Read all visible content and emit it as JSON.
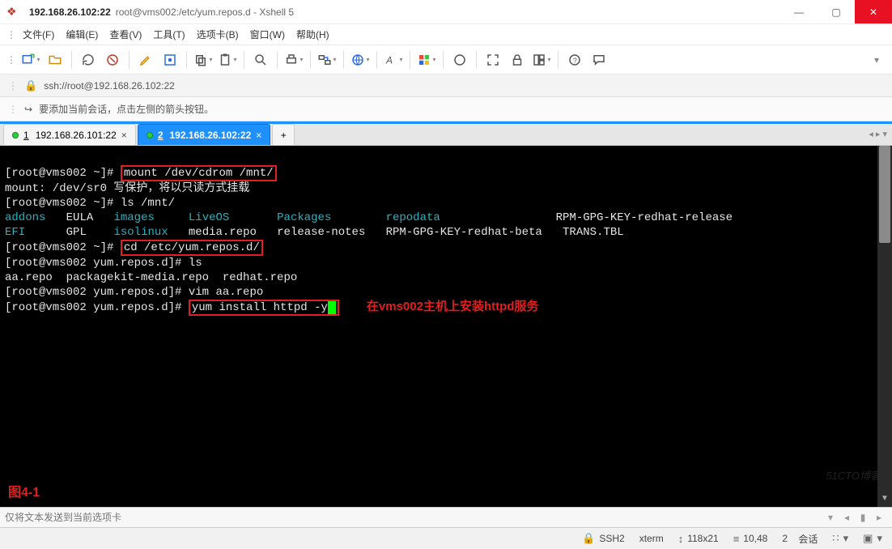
{
  "window": {
    "host": "192.168.26.102:22",
    "subtitle": "root@vms002:/etc/yum.repos.d - Xshell 5"
  },
  "menu": {
    "file": "文件(F)",
    "edit": "编辑(E)",
    "view": "查看(V)",
    "tools": "工具(T)",
    "tabs": "选项卡(B)",
    "window": "窗口(W)",
    "help": "帮助(H)"
  },
  "address": {
    "url": "ssh://root@192.168.26.102:22"
  },
  "hint": {
    "text": "要添加当前会话，点击左侧的箭头按钮。"
  },
  "tabs": [
    {
      "num": "1",
      "label": "192.168.26.101:22",
      "active": false
    },
    {
      "num": "2",
      "label": "192.168.26.102:22",
      "active": true
    }
  ],
  "terminal": {
    "lines": {
      "p1_prompt": "[root@vms002 ~]# ",
      "p1_cmd": "mount /dev/cdrom /mnt/",
      "l2": "mount: /dev/sr0 写保护，将以只读方式挂载",
      "p3": "[root@vms002 ~]# ls /mnt/",
      "ls1_c1": "addons",
      "ls1_c2": "EULA",
      "ls1_c3": "images",
      "ls1_c4": "LiveOS",
      "ls1_c5": "Packages",
      "ls1_c6": "repodata",
      "ls1_c7": "RPM-GPG-KEY-redhat-release",
      "ls2_c1": "EFI",
      "ls2_c2": "GPL",
      "ls2_c3": "isolinux",
      "ls2_c4": "media.repo",
      "ls2_c5": "release-notes",
      "ls2_c6": "RPM-GPG-KEY-redhat-beta",
      "ls2_c7": "TRANS.TBL",
      "p6_prompt": "[root@vms002 ~]# ",
      "p6_cmd": "cd /etc/yum.repos.d/",
      "p7": "[root@vms002 yum.repos.d]# ls",
      "l8": "aa.repo  packagekit-media.repo  redhat.repo",
      "p9": "[root@vms002 yum.repos.d]# vim aa.repo",
      "p10_prompt": "[root@vms002 yum.repos.d]# ",
      "p10_cmd": "yum install httpd -y",
      "annotation": "在vms002主机上安装httpd服务"
    },
    "figure_label": "图4-1"
  },
  "input": {
    "placeholder": "仅将文本发送到当前选项卡"
  },
  "status": {
    "proto": "SSH2",
    "term": "xterm",
    "size": "118x21",
    "pos": "10,48",
    "sessions_label": "会话",
    "sessions_count": "2"
  },
  "watermark": "51CTO博客",
  "icons": {
    "min": "—",
    "max": "▢",
    "close": "✕",
    "lock": "🔒",
    "hint_arrow": "↪",
    "plus": "+",
    "updown": "↕",
    "size": "⇲",
    "pos": "≡",
    "sess": "▣",
    "chevdown": "▾",
    "caret_l": "◂",
    "caret_r": "▸",
    "bar": "▮"
  }
}
